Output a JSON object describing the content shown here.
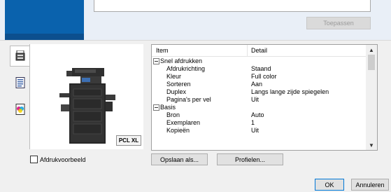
{
  "top": {
    "apply_label": "Toepassen"
  },
  "side_tabs": [
    {
      "icon": "printer-icon",
      "active": true
    },
    {
      "icon": "document-list-icon",
      "active": false
    },
    {
      "icon": "color-icon",
      "active": false
    }
  ],
  "preview": {
    "badge": "PCL XL"
  },
  "checkbox": {
    "label": "Afdrukvoorbeeld",
    "checked": false
  },
  "grid": {
    "headers": {
      "item": "Item",
      "detail": "Detail"
    },
    "rows": [
      {
        "item": "Snel afdrukken",
        "detail": "",
        "group": true
      },
      {
        "item": "Afdrukrichting",
        "detail": "Staand"
      },
      {
        "item": "Kleur",
        "detail": "Full color"
      },
      {
        "item": "Sorteren",
        "detail": "Aan"
      },
      {
        "item": "Duplex",
        "detail": "Langs lange zijde spiegelen"
      },
      {
        "item": "Pagina's per vel",
        "detail": "Uit"
      },
      {
        "item": "Basis",
        "detail": "",
        "group": true
      },
      {
        "item": "Bron",
        "detail": "Auto"
      },
      {
        "item": "Exemplaren",
        "detail": "1"
      },
      {
        "item": "Kopieën",
        "detail": "Uit"
      }
    ]
  },
  "buttons": {
    "save_as": "Opslaan als...",
    "profiles": "Profielen...",
    "ok": "OK",
    "cancel": "Annuleren"
  }
}
